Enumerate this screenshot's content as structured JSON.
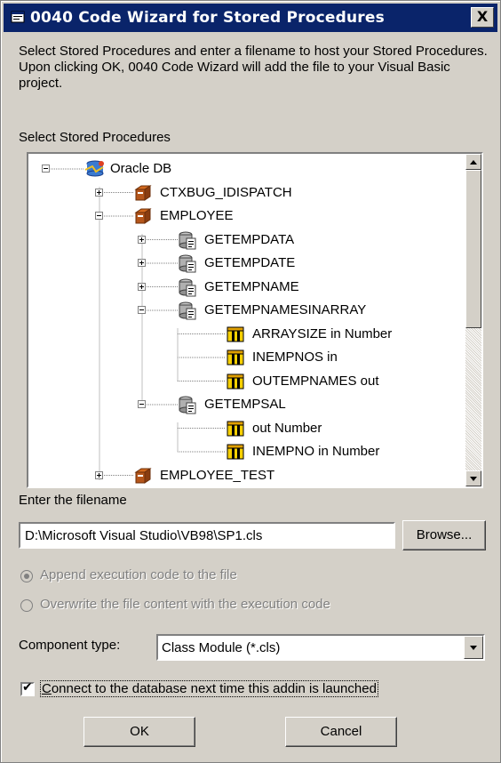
{
  "window": {
    "title": "0040 Code Wizard for Stored Procedures",
    "close_label": "X"
  },
  "description": "Select Stored Procedures and enter a filename to host your Stored Procedures. Upon clicking OK, 0040 Code Wizard will add the file to your Visual Basic project.",
  "tree": {
    "label": "Select Stored Procedures",
    "items": [
      {
        "label": "Oracle DB",
        "level": 0,
        "icon": "database-icon",
        "expander": "minus"
      },
      {
        "label": "CTXBUG_IDISPATCH",
        "level": 1,
        "icon": "package-icon",
        "expander": "plus"
      },
      {
        "label": "EMPLOYEE",
        "level": 1,
        "icon": "package-icon",
        "expander": "minus"
      },
      {
        "label": "GETEMPDATA",
        "level": 2,
        "icon": "procedure-icon",
        "expander": "plus"
      },
      {
        "label": "GETEMPDATE",
        "level": 2,
        "icon": "procedure-icon",
        "expander": "plus"
      },
      {
        "label": "GETEMPNAME",
        "level": 2,
        "icon": "procedure-icon",
        "expander": "plus"
      },
      {
        "label": "GETEMPNAMESINARRAY",
        "level": 2,
        "icon": "procedure-icon",
        "expander": "minus"
      },
      {
        "label": "ARRAYSIZE in Number",
        "level": 3,
        "icon": "parameter-icon",
        "expander": "none"
      },
      {
        "label": "INEMPNOS in",
        "level": 3,
        "icon": "parameter-icon",
        "expander": "none"
      },
      {
        "label": "OUTEMPNAMES out",
        "level": 3,
        "icon": "parameter-icon",
        "expander": "none"
      },
      {
        "label": "GETEMPSAL",
        "level": 2,
        "icon": "procedure-icon",
        "expander": "minus"
      },
      {
        "label": " out Number",
        "level": 3,
        "icon": "parameter-icon",
        "expander": "none"
      },
      {
        "label": "INEMPNO in Number",
        "level": 3,
        "icon": "parameter-icon",
        "expander": "none"
      },
      {
        "label": "EMPLOYEE_TEST",
        "level": 1,
        "icon": "package-icon",
        "expander": "plus"
      }
    ]
  },
  "filename": {
    "label": "Enter the filename",
    "value": "D:\\Microsoft Visual Studio\\VB98\\SP1.cls",
    "browse_label": "Browse..."
  },
  "options": {
    "append_label": "Append execution code to the file",
    "overwrite_label": "Overwrite the file content with the execution code",
    "selected": "append"
  },
  "component": {
    "label": "Component type:",
    "value": "Class Module (*.cls)"
  },
  "connect_checkbox": {
    "label": "Connect to the database next time this addin is launched",
    "checked": true
  },
  "buttons": {
    "ok": "OK",
    "cancel": "Cancel"
  },
  "colors": {
    "titlebar": "#0a246a",
    "face": "#d4d0c8",
    "package_icon": "#a0522d",
    "parameter_icon": "#e0a000"
  }
}
